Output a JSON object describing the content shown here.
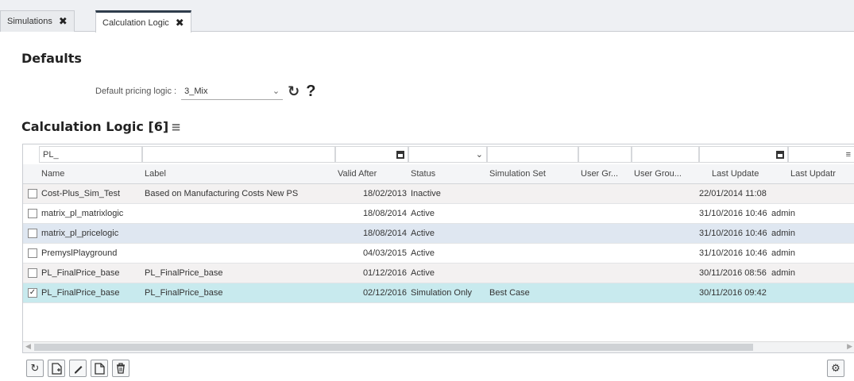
{
  "tabs": [
    {
      "label": "Simulations",
      "close": "✖"
    },
    {
      "label": "Calculation Logic",
      "close": "✖"
    }
  ],
  "defaults": {
    "title": "Defaults",
    "pricing_label": "Default pricing logic :",
    "pricing_value": "3_Mix",
    "help": "?"
  },
  "grid": {
    "title": "Calculation Logic [6]",
    "filter_name": "PL_",
    "columns": [
      "Name",
      "Label",
      "Valid After",
      "Status",
      "Simulation Set",
      "User Gr...",
      "User Grou...",
      "Last Update",
      "Last Updatr"
    ],
    "rows": [
      {
        "checked": false,
        "name": "Cost-Plus_Sim_Test",
        "label": "Based on Manufacturing Costs New PS",
        "valid_after": "18/02/2013",
        "status": "Inactive",
        "simulation_set": "",
        "last_update": "22/01/2014 11:08",
        "last_update_by": ""
      },
      {
        "checked": false,
        "name": "matrix_pl_matrixlogic",
        "label": "",
        "valid_after": "18/08/2014",
        "status": "Active",
        "simulation_set": "",
        "last_update": "31/10/2016 10:46",
        "last_update_by": "admin"
      },
      {
        "checked": false,
        "name": "matrix_pl_pricelogic",
        "label": "",
        "valid_after": "18/08/2014",
        "status": "Active",
        "simulation_set": "",
        "last_update": "31/10/2016 10:46",
        "last_update_by": "admin"
      },
      {
        "checked": false,
        "name": "PremyslPlayground",
        "label": "",
        "valid_after": "04/03/2015",
        "status": "Active",
        "simulation_set": "",
        "last_update": "31/10/2016 10:46",
        "last_update_by": "admin"
      },
      {
        "checked": false,
        "name": "PL_FinalPrice_base",
        "label": "PL_FinalPrice_base",
        "valid_after": "01/12/2016",
        "status": "Active",
        "simulation_set": "",
        "last_update": "30/11/2016 08:56",
        "last_update_by": "admin"
      },
      {
        "checked": true,
        "name": "PL_FinalPrice_base",
        "label": "PL_FinalPrice_base",
        "valid_after": "02/12/2016",
        "status": "Simulation Only",
        "simulation_set": "Best Case",
        "last_update": "30/11/2016 09:42",
        "last_update_by": ""
      }
    ]
  },
  "toolbar": {
    "buttons": [
      "refresh-icon",
      "new-document-icon",
      "edit-pencil-icon",
      "copy-document-icon",
      "trash-icon"
    ],
    "settings": "gear-icon"
  }
}
